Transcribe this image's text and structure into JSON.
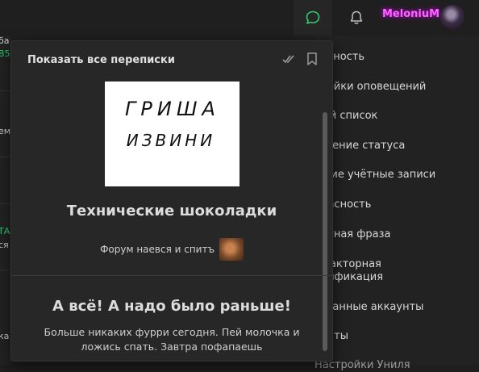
{
  "topbar": {
    "username": "MeloniuM",
    "chat_icon": "chat-bubble-icon",
    "bell_icon": "bell-icon",
    "accent": "#ff64ff"
  },
  "left_strip": {
    "fragments": [
      "ба",
      "B5",
      "ем",
      "ТА",
      "ся",
      "ка"
    ]
  },
  "right_menu": {
    "items": [
      "ватность",
      "тройки оповещений",
      "ный список",
      "ышение статуса",
      "шние учётные записи",
      "опасность",
      "ретная фраза",
      "кфакторная",
      "нтификация",
      "вязанные аккаунты",
      "чанты",
      "Настройки Униля"
    ]
  },
  "panel": {
    "title": "Показать все переписки",
    "mark_read_icon": "double-check-icon",
    "bookmark_icon": "bookmark-icon",
    "conversations": [
      {
        "image_text_line1": "ГРИША",
        "image_text_line2": "ИЗВИНИ",
        "title": "Технические шоколадки",
        "last_message": "Форум наевся и спитъ"
      },
      {
        "title": "А всё! А надо было раньше!",
        "description": "Больше никаких фурри сегодня. Пей молочка и ложись спать. Завтра пофапаешь"
      }
    ]
  }
}
